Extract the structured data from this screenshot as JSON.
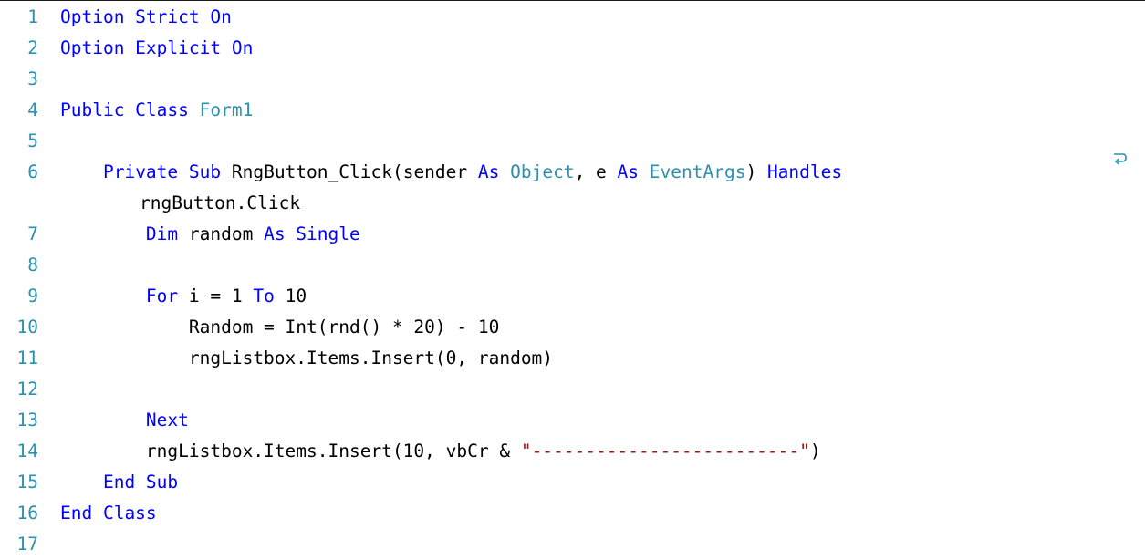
{
  "code": {
    "colors": {
      "keyword": "#0000ff",
      "type": "#2b91af",
      "string": "#a31515",
      "line_number": "#2b91af",
      "text": "#000000"
    },
    "lines": [
      {
        "num": "1",
        "tokens": [
          {
            "t": "Option Strict On",
            "c": "kw"
          }
        ]
      },
      {
        "num": "2",
        "tokens": [
          {
            "t": "Option Explicit On",
            "c": "kw"
          }
        ]
      },
      {
        "num": "3",
        "tokens": []
      },
      {
        "num": "4",
        "tokens": [
          {
            "t": "Public Class ",
            "c": "kw"
          },
          {
            "t": "Form1",
            "c": "ty"
          }
        ]
      },
      {
        "num": "5",
        "tokens": []
      },
      {
        "num": "6",
        "tokens": [
          {
            "t": "    "
          },
          {
            "t": "Private Sub ",
            "c": "kw"
          },
          {
            "t": "RngButton_Click(sender "
          },
          {
            "t": "As ",
            "c": "kw"
          },
          {
            "t": "Object",
            "c": "ty"
          },
          {
            "t": ", e "
          },
          {
            "t": "As ",
            "c": "kw"
          },
          {
            "t": "EventArgs",
            "c": "ty"
          },
          {
            "t": ") "
          },
          {
            "t": "Handles",
            "c": "kw"
          }
        ]
      },
      {
        "num": "",
        "continuation": true,
        "tokens": [
          {
            "t": "rngButton.Click"
          }
        ]
      },
      {
        "num": "7",
        "tokens": [
          {
            "t": "        "
          },
          {
            "t": "Dim ",
            "c": "kw"
          },
          {
            "t": "random "
          },
          {
            "t": "As Single",
            "c": "kw"
          }
        ]
      },
      {
        "num": "8",
        "tokens": []
      },
      {
        "num": "9",
        "tokens": [
          {
            "t": "        "
          },
          {
            "t": "For ",
            "c": "kw"
          },
          {
            "t": "i = 1 "
          },
          {
            "t": "To ",
            "c": "kw"
          },
          {
            "t": "10"
          }
        ]
      },
      {
        "num": "10",
        "tokens": [
          {
            "t": "            Random = Int(rnd() * 20) - 10"
          }
        ]
      },
      {
        "num": "11",
        "tokens": [
          {
            "t": "            rngListbox.Items.Insert(0, random)"
          }
        ]
      },
      {
        "num": "12",
        "tokens": []
      },
      {
        "num": "13",
        "tokens": [
          {
            "t": "        "
          },
          {
            "t": "Next",
            "c": "kw"
          }
        ]
      },
      {
        "num": "14",
        "tokens": [
          {
            "t": "        rngListbox.Items.Insert(10, vbCr & "
          },
          {
            "t": "\"-------------------------\"",
            "c": "str"
          },
          {
            "t": ")"
          }
        ]
      },
      {
        "num": "15",
        "tokens": [
          {
            "t": "    "
          },
          {
            "t": "End Sub",
            "c": "kw"
          }
        ]
      },
      {
        "num": "16",
        "tokens": [
          {
            "t": "End Class",
            "c": "kw"
          }
        ]
      },
      {
        "num": "17",
        "tokens": []
      }
    ],
    "wrap_icon": "word-wrap-arrow-icon"
  }
}
